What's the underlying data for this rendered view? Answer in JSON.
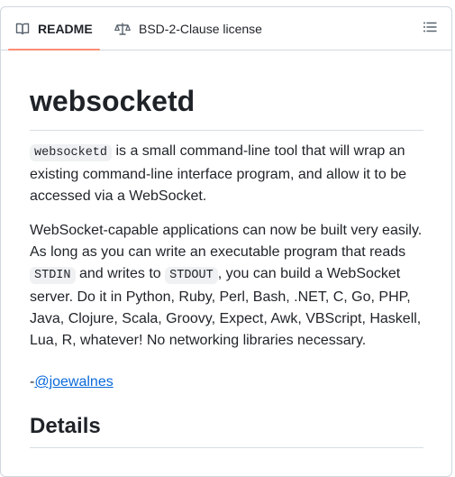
{
  "tabs": [
    {
      "label": "README",
      "icon": "book-icon",
      "active": true
    },
    {
      "label": "BSD-2-Clause license",
      "icon": "law-scale-icon",
      "active": false
    }
  ],
  "outline_icon": "list-unordered-icon",
  "colors": {
    "accent_underline": "#fd8c73",
    "link": "#0969da",
    "text": "#1f2328",
    "border": "#d0d7de"
  },
  "readme": {
    "title": "websocketd",
    "intro": {
      "code": "websocketd",
      "text": " is a small command-line tool that will wrap an existing command-line interface program, and allow it to be accessed via a WebSocket."
    },
    "para2": {
      "before_stdin": "WebSocket-capable applications can now be built very easily. As long as you can write an executable program that reads ",
      "stdin": "STDIN",
      "middle": " and writes to ",
      "stdout": "STDOUT",
      "after": ", you can build a WebSocket server. Do it in Python, Ruby, Perl, Bash, .NET, C, Go, PHP, Java, Clojure, Scala, Groovy, Expect, Awk, VBScript, Haskell, Lua, R, whatever! No networking libraries necessary."
    },
    "signature": {
      "prefix": "-",
      "link": "@joewalnes"
    },
    "details_heading": "Details"
  }
}
